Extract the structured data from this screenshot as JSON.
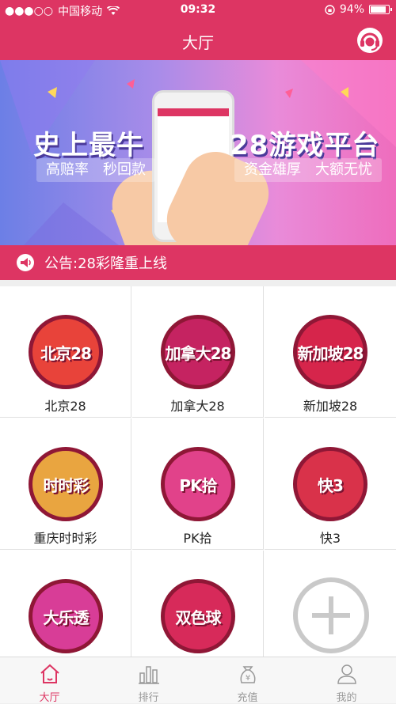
{
  "status_bar": {
    "carrier": "中国移动",
    "time": "09:32",
    "battery": "94%",
    "battery_level": 0.94
  },
  "header": {
    "title": "大厅"
  },
  "banner": {
    "headline_left": "史上最牛",
    "headline_right": "28游戏平台",
    "tag_left": "高赔率　秒回款",
    "tag_right": "资金雄厚　大额无忧"
  },
  "notice": {
    "text": "公告:28彩隆重上线"
  },
  "games": [
    {
      "label": "北京28",
      "badge": "北京28",
      "color": "#e8433a"
    },
    {
      "label": "加拿大28",
      "badge": "加拿大28",
      "color": "#c52361"
    },
    {
      "label": "新加坡28",
      "badge": "新加坡28",
      "color": "#d6254b"
    },
    {
      "label": "重庆时时彩",
      "badge": "时时彩",
      "color": "#e9a540"
    },
    {
      "label": "PK拾",
      "badge": "PK拾",
      "color": "#e1428a"
    },
    {
      "label": "快3",
      "badge": "快3",
      "color": "#d9324a"
    },
    {
      "label": "",
      "badge": "大乐透",
      "color": "#d83d97"
    },
    {
      "label": "",
      "badge": "双色球",
      "color": "#d72a5a"
    }
  ],
  "tabs": [
    {
      "label": "大厅",
      "icon": "home-icon"
    },
    {
      "label": "排行",
      "icon": "bar-chart-icon"
    },
    {
      "label": "充值",
      "icon": "money-bag-icon"
    },
    {
      "label": "我的",
      "icon": "user-icon"
    }
  ],
  "colors": {
    "brand": "#dd3563",
    "inactive": "#999999"
  }
}
